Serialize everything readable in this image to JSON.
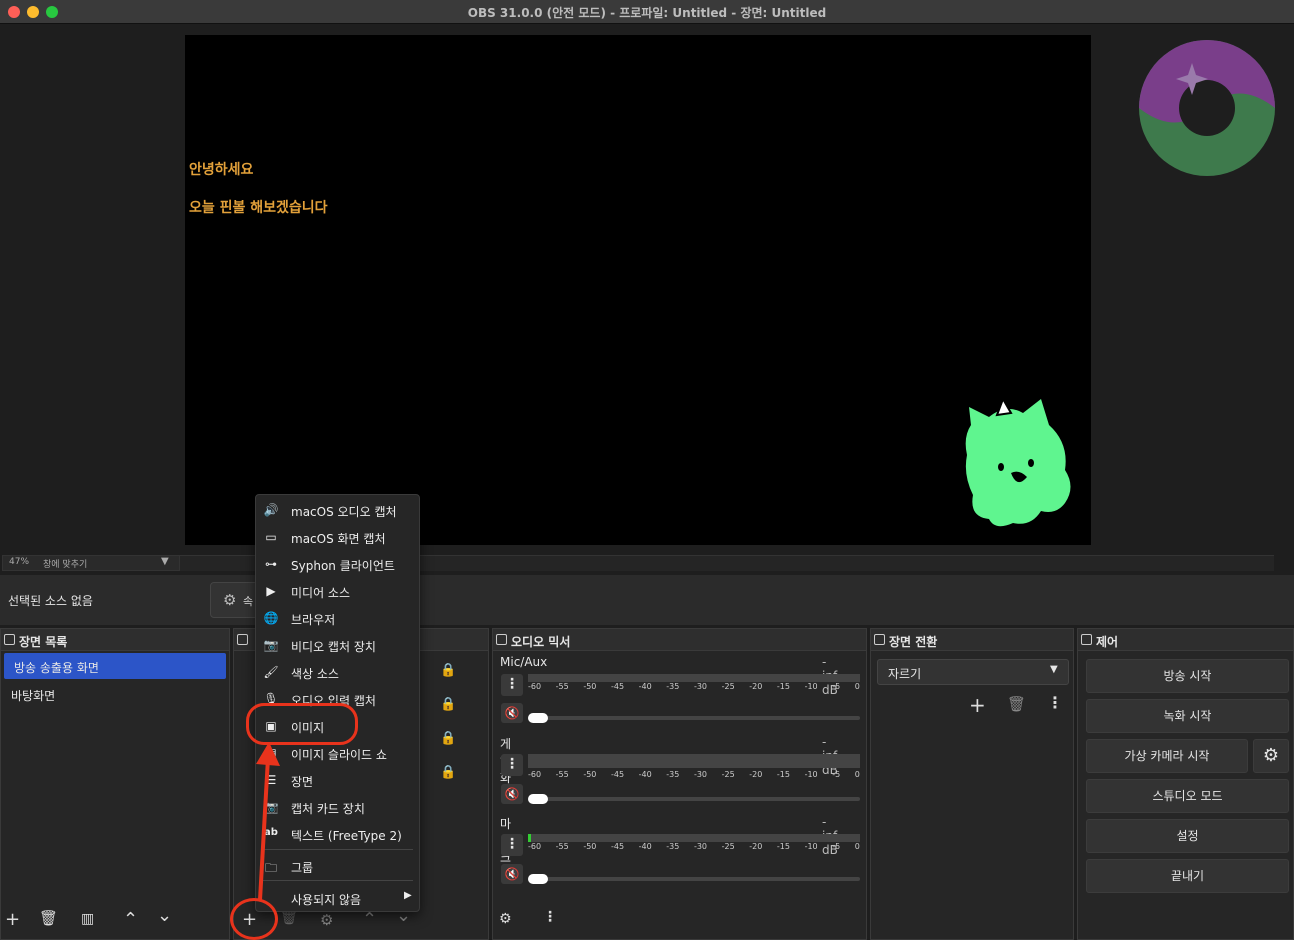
{
  "window": {
    "title": "OBS 31.0.0 (안전 모드) - 프로파일: Untitled - 장면: Untitled"
  },
  "preview": {
    "line1": "안녕하세요",
    "line2": "오늘 핀볼 해보겠습니다"
  },
  "zoom": {
    "percent": "47%",
    "mode": "창에 맞추기"
  },
  "source_context": {
    "no_source": "선택된 소스 없음",
    "properties_partial": "속"
  },
  "scenes": {
    "title": "장면 목록",
    "items": [
      "방송 송출용 화면",
      "바탕화면"
    ],
    "selected": 0
  },
  "mixer": {
    "title": "오디오 믹서",
    "channels": [
      {
        "name": "Mic/Aux",
        "db": "-inf dB"
      },
      {
        "name": "게임 화면",
        "db": "-inf dB"
      },
      {
        "name": "마이크",
        "db": "-inf dB"
      }
    ],
    "ticks": [
      "-60",
      "-55",
      "-50",
      "-45",
      "-40",
      "-35",
      "-30",
      "-25",
      "-20",
      "-15",
      "-10",
      "-5",
      "0"
    ]
  },
  "transitions": {
    "title": "장면 전환",
    "selected": "자르기"
  },
  "controls": {
    "title": "제어",
    "buttons": [
      "방송 시작",
      "녹화 시작",
      "가상 카메라 시작",
      "스튜디오 모드",
      "설정",
      "끝내기"
    ]
  },
  "add_menu": {
    "items": [
      "macOS 오디오 캡처",
      "macOS 화면 캡처",
      "Syphon 클라이언트",
      "미디어 소스",
      "브라우저",
      "비디오 캡처 장치",
      "색상 소스",
      "오디오 입력 캡처",
      "이미지",
      "이미지 슬라이드 쇼",
      "장면",
      "캡처 카드 장치",
      "텍스트 (FreeType 2)",
      "그룹",
      "사용되지 않음"
    ]
  },
  "colors": {
    "accent": "#2c55c8",
    "annotation": "#e8331c",
    "preview_text": "#e3a13a",
    "mascot": "#5ff58f"
  }
}
